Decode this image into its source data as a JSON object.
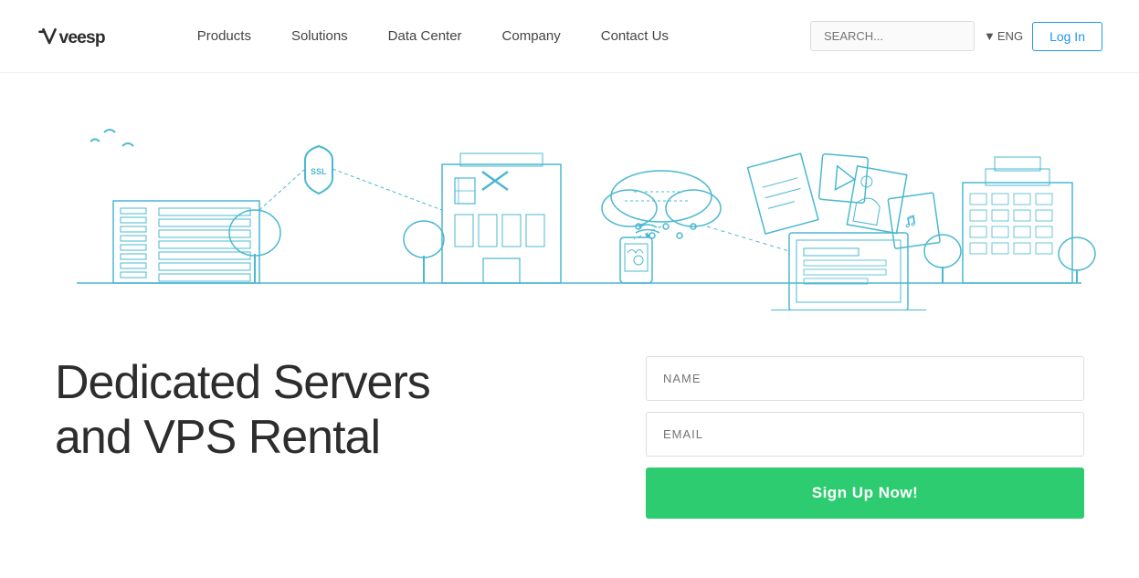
{
  "header": {
    "logo_text": "veesp",
    "nav_items": [
      {
        "label": "Products",
        "href": "#"
      },
      {
        "label": "Solutions",
        "href": "#"
      },
      {
        "label": "Data Center",
        "href": "#"
      },
      {
        "label": "Company",
        "href": "#"
      },
      {
        "label": "Contact Us",
        "href": "#"
      }
    ],
    "search_placeholder": "SEARCH...",
    "lang_label": "ENG",
    "login_label": "Log In"
  },
  "form": {
    "name_placeholder": "NAME",
    "email_placeholder": "EMAIL",
    "signup_label": "Sign Up Now!"
  },
  "hero": {
    "heading_line1": "Dedicated Servers",
    "heading_line2": "and VPS Rental"
  },
  "colors": {
    "accent_blue": "#4ab8d0",
    "accent_green": "#2ecc71",
    "line_color": "#5bc8d8"
  }
}
